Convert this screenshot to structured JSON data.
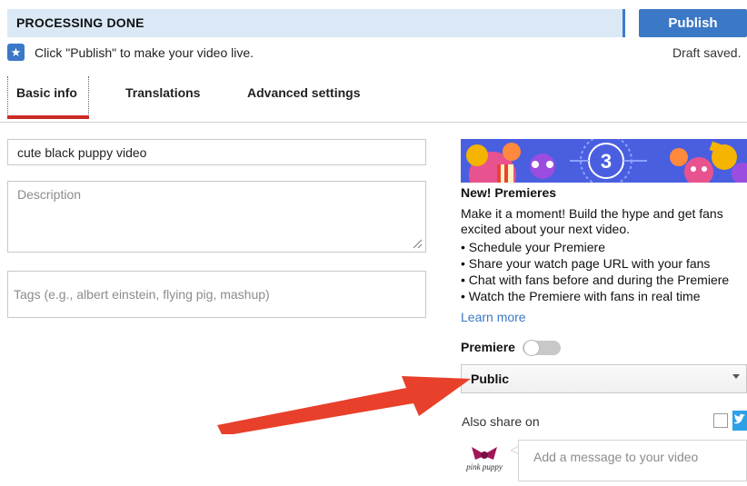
{
  "status_bar": {
    "text": "PROCESSING DONE"
  },
  "actions": {
    "publish_label": "Publish"
  },
  "info": {
    "hint": "Click \"Publish\" to make your video live.",
    "draft": "Draft saved.",
    "star_icon": "star-icon"
  },
  "tabs": [
    {
      "label": "Basic info",
      "active": true
    },
    {
      "label": "Translations",
      "active": false
    },
    {
      "label": "Advanced settings",
      "active": false
    }
  ],
  "form": {
    "title_value": "cute black puppy video",
    "description_placeholder": "Description",
    "tags_placeholder": "Tags (e.g., albert einstein, flying pig, mashup)"
  },
  "premiere": {
    "banner_number": "3",
    "title": "New! Premieres",
    "description": "Make it a moment! Build the hype and get fans excited about your next video.",
    "bullets": [
      "Schedule your Premiere",
      "Share your watch page URL with your fans",
      "Chat with fans before and during the Premiere",
      "Watch the Premiere with fans in real time"
    ],
    "learn_more": "Learn more",
    "toggle_label": "Premiere",
    "toggle_on": false
  },
  "visibility": {
    "selected": "Public"
  },
  "share": {
    "label": "Also share on",
    "message_placeholder": "Add a message to your video",
    "avatar_text": "pink puppy"
  },
  "colors": {
    "accent_blue": "#3b78c5",
    "status_bg": "#dbe9f7",
    "tab_underline": "#cc2a24",
    "arrow_red": "#e8402a",
    "banner_blue": "#4a5fe0"
  }
}
